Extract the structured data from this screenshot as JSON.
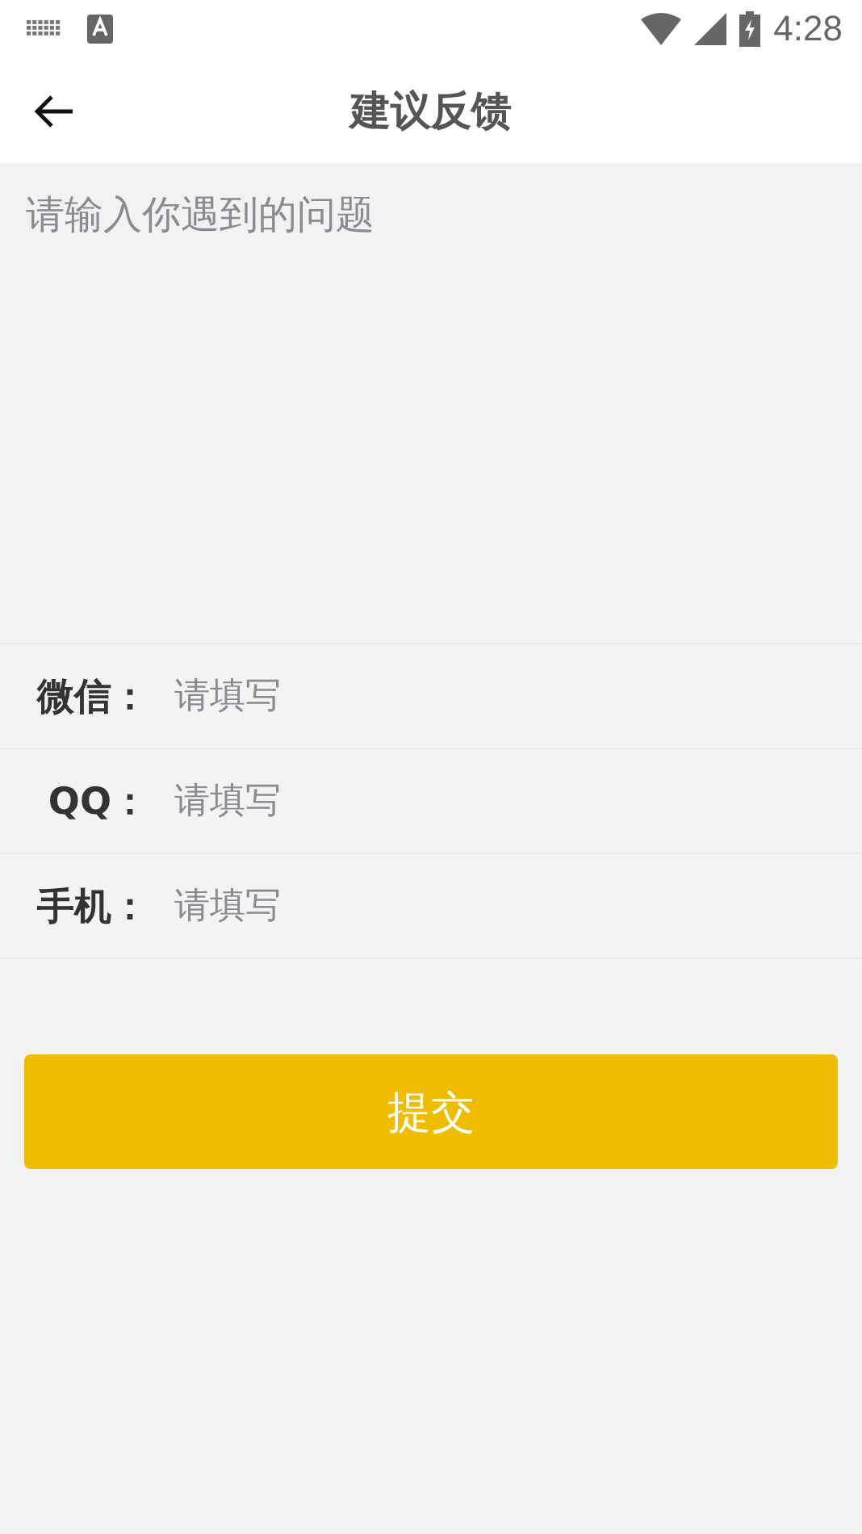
{
  "status_bar": {
    "time": "4:28"
  },
  "header": {
    "title": "建议反馈"
  },
  "question": {
    "placeholder": "请输入你遇到的问题"
  },
  "contact_fields": [
    {
      "label": "微信：",
      "placeholder": "请填写"
    },
    {
      "label": "QQ：",
      "placeholder": "请填写"
    },
    {
      "label": "手机：",
      "placeholder": "请填写"
    }
  ],
  "submit_button": "提交"
}
